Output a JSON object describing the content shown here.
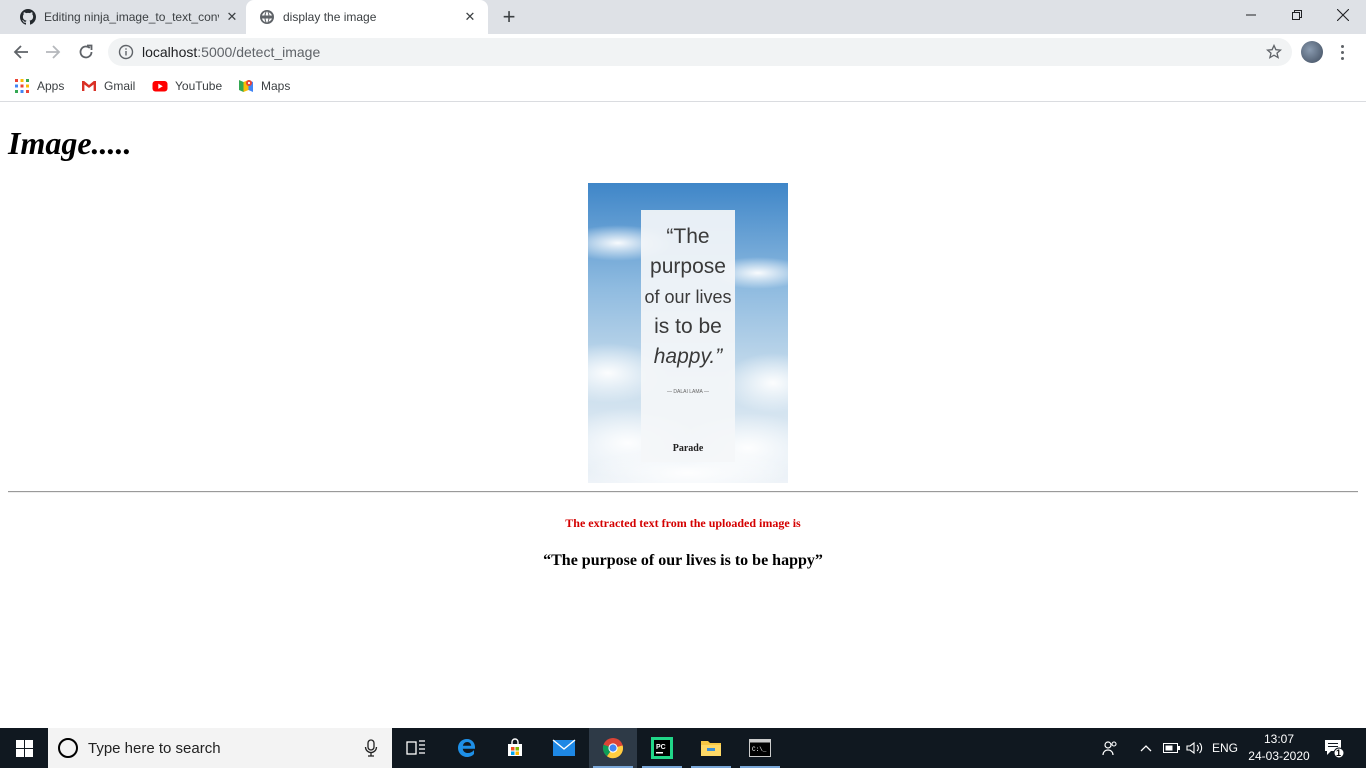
{
  "browser": {
    "tabs": [
      {
        "title": "Editing ninja_image_to_text_conv",
        "favicon": "github-icon",
        "active": false
      },
      {
        "title": "display the image",
        "favicon": "globe-icon",
        "active": true
      }
    ],
    "address": {
      "host": "localhost",
      "path": ":5000/detect_image"
    },
    "bookmarks": [
      {
        "label": "Apps",
        "icon": "apps-grid-icon"
      },
      {
        "label": "Gmail",
        "icon": "gmail-icon"
      },
      {
        "label": "YouTube",
        "icon": "youtube-icon"
      },
      {
        "label": "Maps",
        "icon": "maps-icon"
      }
    ]
  },
  "page": {
    "title": "Image.....",
    "quote_image": {
      "lines": [
        "“The",
        "purpose",
        "of our lives",
        "is to be",
        "happy.”"
      ],
      "attribution": "— DALAI LAMA —",
      "brand": "Parade"
    },
    "extract_label": "The extracted text from the uploaded image is",
    "extract_text": "“The purpose of our lives is to be happy”"
  },
  "taskbar": {
    "search_placeholder": "Type here to search",
    "language": "ENG",
    "time": "13:07",
    "date": "24-03-2020",
    "notification_count": "1"
  },
  "colors": {
    "tabstrip": "#dee1e6",
    "extract_label": "#d40000",
    "taskbar": "#101820"
  }
}
